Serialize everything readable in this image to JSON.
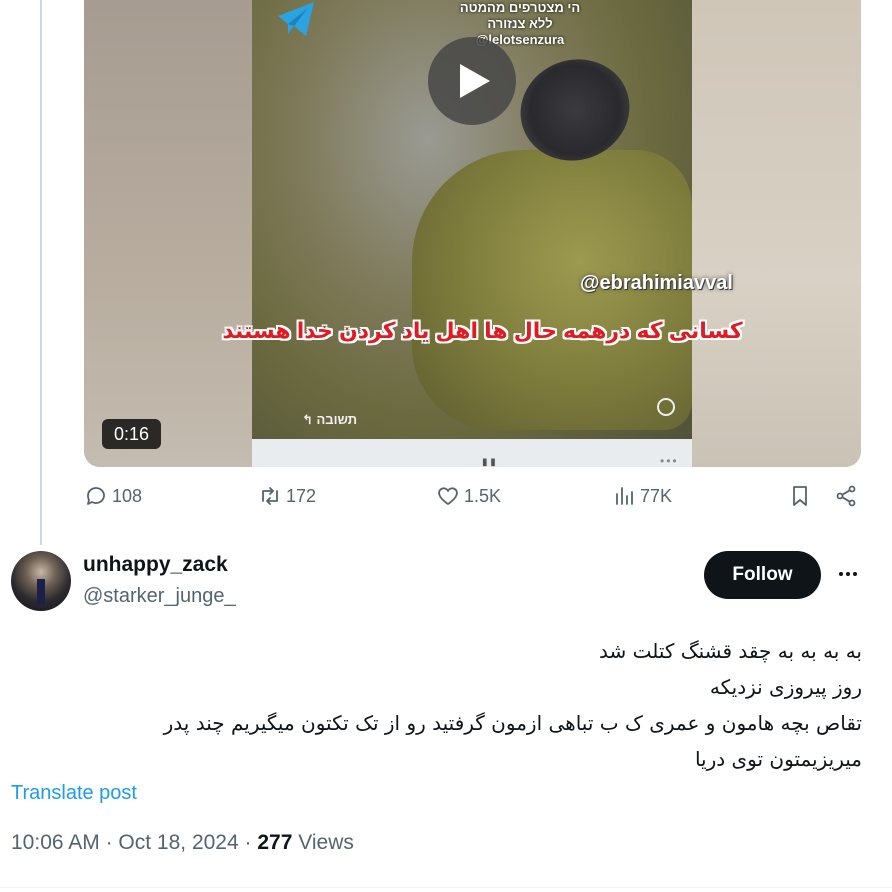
{
  "media": {
    "watermark_hebrew_line1": "הי מצטרפים מהמטה",
    "watermark_hebrew_line2": "ללא צנזורה",
    "watermark_telegram_handle": "@lelotsenzura",
    "watermark_handle": "@ebrahimiavval",
    "caption_persian": "کسانی که درهمه حال ها اهل یاد کردن خدا هستند",
    "reply_label_hebrew": "תשובה",
    "duration": "0:16",
    "play_icon": "play-icon"
  },
  "actions": {
    "replies": "108",
    "reposts": "172",
    "likes": "1.5K",
    "views": "77K"
  },
  "reply_post": {
    "display_name": "unhappy_zack",
    "username": "@starker_junge_",
    "follow_label": "Follow",
    "text_lines": [
      "به به به به چقد قشنگ کتلت شد",
      "روز پیروزی نزدیکه",
      "تقاص بچه هامون و عمری ک ب تباهی ازمون گرفتید رو از تک تکتون میگیریم چند پدر",
      "میریزیمتون توی دریا"
    ],
    "translate_label": "Translate post",
    "time": "10:06 AM",
    "date": "Oct 18, 2024",
    "separator": "·",
    "view_count": "277",
    "views_label": "Views"
  },
  "colors": {
    "text_primary": "#0f1419",
    "text_secondary": "#536471",
    "link_blue": "#1d9bf0",
    "caption_red": "#e01b24"
  }
}
